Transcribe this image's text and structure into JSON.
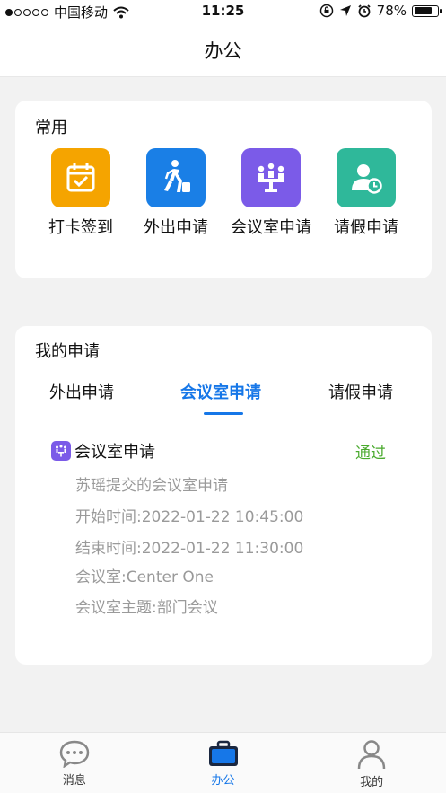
{
  "status_bar": {
    "carrier": "中国移动",
    "time": "11:25",
    "battery": "78%",
    "battery_level": 0.78
  },
  "nav": {
    "title": "办公"
  },
  "common": {
    "title": "常用",
    "items": [
      {
        "label": "打卡签到",
        "icon": "calendar-check-icon",
        "color": "#f5a400"
      },
      {
        "label": "外出申请",
        "icon": "walking-person-icon",
        "color": "#1a7fe6"
      },
      {
        "label": "会议室申请",
        "icon": "meeting-room-icon",
        "color": "#7b5be8"
      },
      {
        "label": "请假申请",
        "icon": "person-clock-icon",
        "color": "#2fb89a"
      }
    ]
  },
  "applications": {
    "title": "我的申请",
    "tabs": [
      {
        "label": "外出申请",
        "active": false
      },
      {
        "label": "会议室申请",
        "active": true
      },
      {
        "label": "请假申请",
        "active": false
      }
    ],
    "item": {
      "title": "会议室申请",
      "status": "通过",
      "submitter": "苏瑶提交的会议室申请",
      "start_time": "开始时间:2022-01-22 10:45:00",
      "end_time": "结束时间:2022-01-22 11:30:00",
      "room": "会议室:Center One",
      "topic": "会议室主题:部门会议"
    }
  },
  "tab_bar": {
    "items": [
      {
        "label": "消息",
        "icon": "chat-bubble-icon",
        "active": false
      },
      {
        "label": "办公",
        "icon": "briefcase-icon",
        "active": true
      },
      {
        "label": "我的",
        "icon": "user-icon",
        "active": false
      }
    ]
  },
  "colors": {
    "accent": "#1677e8",
    "approved": "#4aaa2e"
  }
}
